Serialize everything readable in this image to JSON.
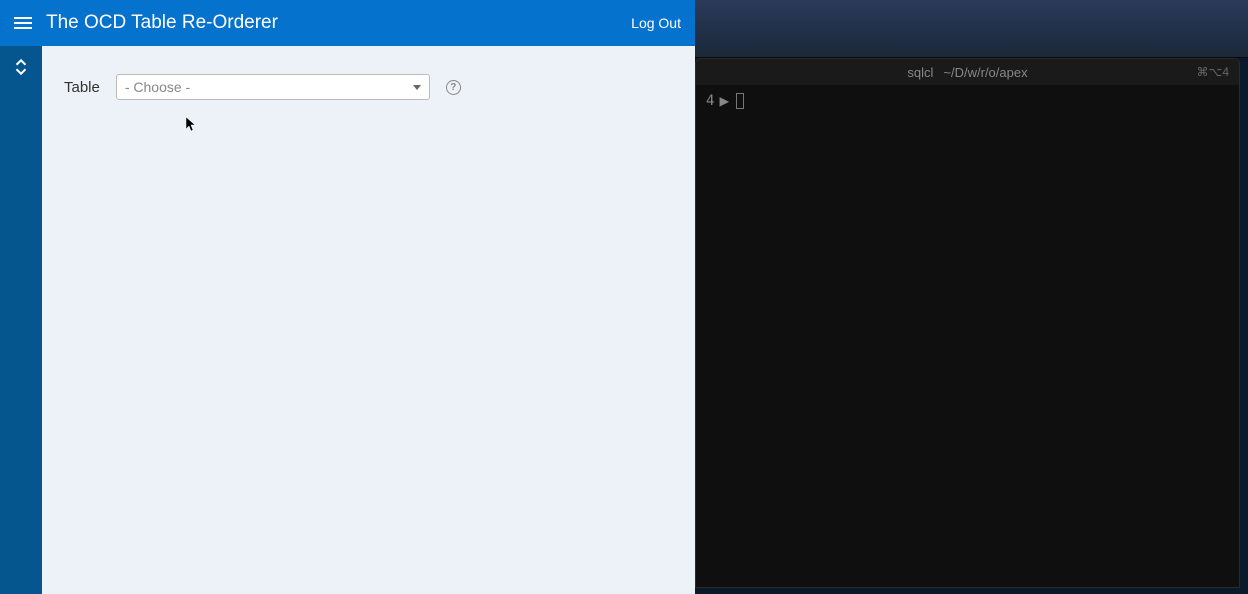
{
  "header": {
    "title": "The OCD Table Re-Orderer",
    "logout_label": "Log Out"
  },
  "form": {
    "table_label": "Table",
    "table_select_placeholder": "- Choose -"
  },
  "terminal": {
    "title_app": "sqlcl",
    "title_path": "~/D/w/r/o/apex",
    "shortcut_hint": "⌘⌥4",
    "prompt_number": "4"
  }
}
